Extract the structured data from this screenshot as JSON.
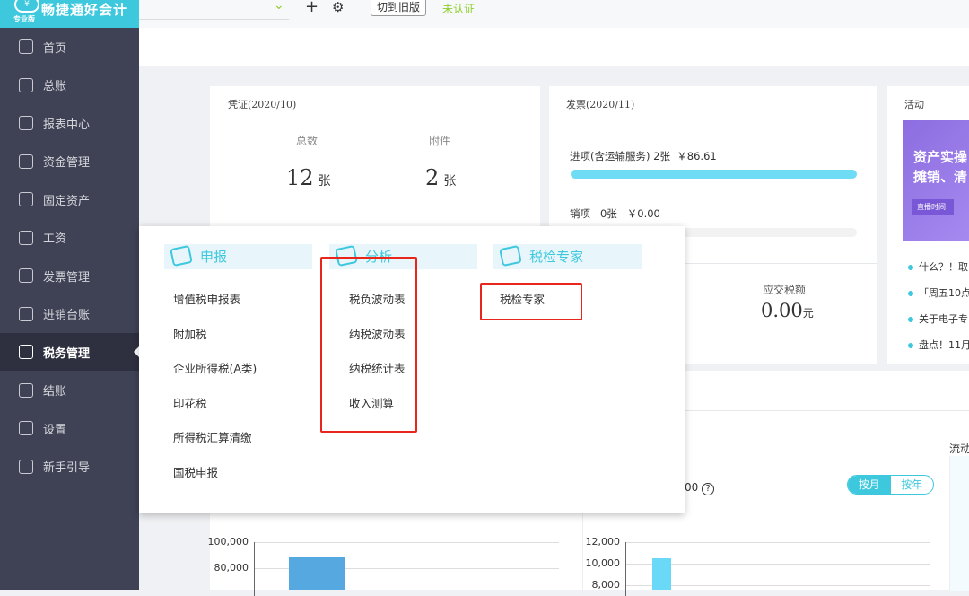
{
  "app": {
    "logo_name": "畅捷通好会计",
    "edition": "专业版"
  },
  "sidebar": {
    "items": [
      {
        "label": "首页",
        "icon": "home-icon"
      },
      {
        "label": "总账",
        "icon": "ledger-icon"
      },
      {
        "label": "报表中心",
        "icon": "report-icon"
      },
      {
        "label": "资金管理",
        "icon": "money-bag-icon"
      },
      {
        "label": "固定资产",
        "icon": "building-icon"
      },
      {
        "label": "工资",
        "icon": "salary-icon"
      },
      {
        "label": "发票管理",
        "icon": "invoice-icon"
      },
      {
        "label": "进销台账",
        "icon": "inventory-icon"
      },
      {
        "label": "税务管理",
        "icon": "tax-icon",
        "active": true
      },
      {
        "label": "结账",
        "icon": "close-books-icon"
      },
      {
        "label": "设置",
        "icon": "gear-icon"
      },
      {
        "label": "新手引导",
        "icon": "guide-icon"
      }
    ]
  },
  "topbar": {
    "switch_old": "切到旧版",
    "status": "未认证",
    "status_color": "#8fcf2e"
  },
  "voucher": {
    "title": "凭证(2020/10)",
    "total_label": "总数",
    "total_value": "12",
    "total_unit": "张",
    "attach_label": "附件",
    "attach_value": "2",
    "attach_unit": "张"
  },
  "invoice": {
    "title": "发票(2020/11)",
    "input_label": "进项(含运输服务)",
    "input_count": "2张",
    "input_amount": "￥86.61",
    "input_progress": 1.0,
    "output_label": "销项",
    "output_count": "0张",
    "output_amount": "￥0.00",
    "output_progress": 0,
    "tax_label": "应交税额",
    "tax_value": "0.00",
    "tax_unit": "元"
  },
  "activity": {
    "title": "活动",
    "banner_line1": "资产实操",
    "banner_line2": "摊销、清",
    "banner_sub": "直播时间:",
    "news": [
      "什么？！取",
      "「周五10点",
      "关于电子专",
      "盘点！11月"
    ]
  },
  "popup": {
    "sections": [
      {
        "title": "申报",
        "items": [
          "增值税申报表",
          "附加税",
          "企业所得税(A类)",
          "印花税",
          "所得税汇算清缴",
          "国税申报"
        ]
      },
      {
        "title": "分析",
        "items": [
          "税负波动表",
          "纳税波动表",
          "纳税统计表",
          "收入测算"
        ]
      },
      {
        "title": "税检专家",
        "items": [
          "税检专家"
        ]
      }
    ]
  },
  "lower": {
    "partial_value": "00",
    "toggle": [
      "按月",
      "按年"
    ],
    "right_title": "流动"
  },
  "chart_data": [
    {
      "type": "bar",
      "y_ticks": [
        "100,000",
        "80,000"
      ],
      "values": [
        89000
      ],
      "ylim": [
        0,
        100000
      ],
      "grid": true,
      "color": "#55a8e0"
    },
    {
      "type": "bar",
      "y_ticks": [
        "12,000",
        "10,000",
        "8,000"
      ],
      "values": [
        10500
      ],
      "ylim": [
        0,
        12000
      ],
      "grid": true,
      "color": "#6ad8f7"
    }
  ]
}
